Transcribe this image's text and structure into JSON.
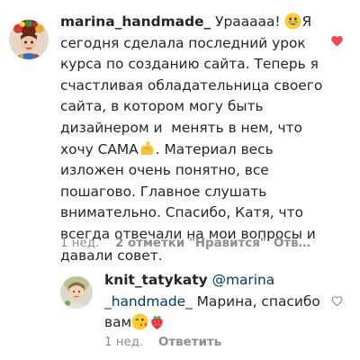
{
  "comment": {
    "username": "marina_handmade_",
    "text_parts": {
      "t1": " Урааааа! ",
      "t2": "Я сегодня сделала последний урок курса по созданию сайта. Теперь я счастливая обладательница своего сайта, в котором могу быть дизайнером и  менять в нем, что хочу САМА",
      "t3": ". Материал весь изложен очень понятно, все пошагово. Главное слушать внимательно. Спасибо, Катя, что всегда отвечали на мои вопросы и давали совет."
    },
    "emoji_1": "grinning-face-emoji",
    "emoji_2": "flexed-biceps-emoji",
    "time": "1 нед.",
    "likes": "2 отметки \"Нравится\"",
    "reply_label": "Отв…",
    "liked": true,
    "heart_icon": "heart-filled-icon",
    "heart_color": "#ed4956",
    "avatar": "user-avatar"
  },
  "reply": {
    "username": "knit_tatykaty",
    "mention": "@marina _handmade_",
    "text": " Марина, спасибо вам",
    "emoji_1": "face-blowing-kiss-emoji",
    "emoji_2": "strawberry-emoji",
    "time": "1 нед.",
    "reply_label": "Ответить",
    "liked": false,
    "heart_icon": "heart-outline-icon",
    "avatar": "user-avatar"
  },
  "colors": {
    "text": "#262626",
    "secondary": "#8e8e8e",
    "mention": "#00376b",
    "like": "#ed4956"
  }
}
